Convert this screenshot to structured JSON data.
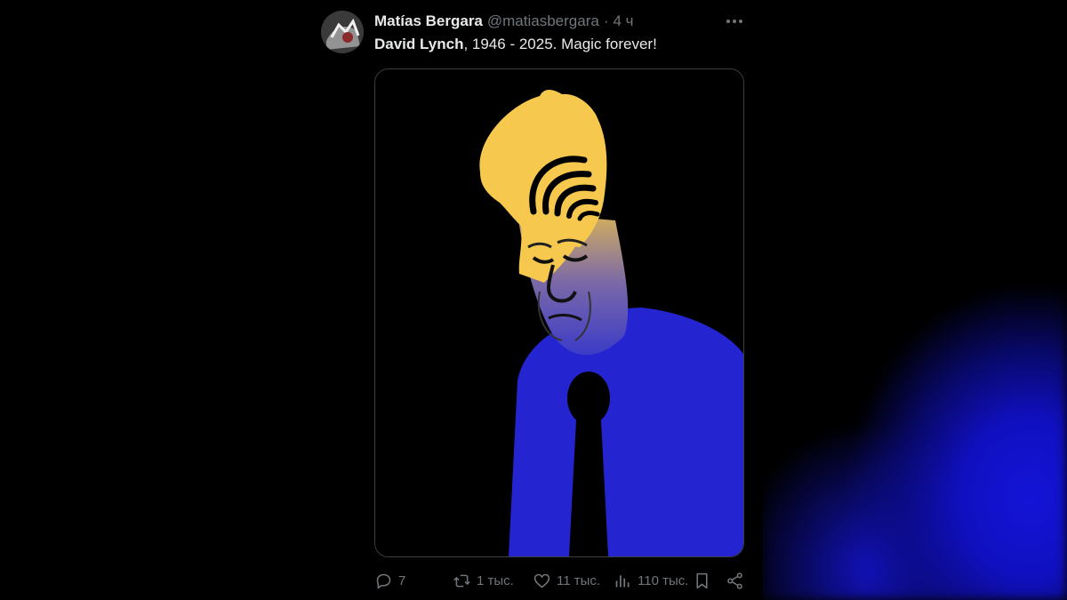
{
  "tweet": {
    "author_name": "Matías Bergara",
    "handle": "@matiasbergara",
    "separator": "·",
    "time": "4 ч",
    "text_bold": "David Lynch",
    "text_rest": ", 1946 - 2025. Magic forever!",
    "media_icon": "illustration-image"
  },
  "actions": {
    "replies": "7",
    "reposts": "1 тыс.",
    "likes": "11 тыс.",
    "views": "110 тыс."
  },
  "icons": {
    "more": "more-dots-icon",
    "reply": "reply-icon",
    "repost": "repost-icon",
    "like": "heart-icon",
    "views": "views-chart-icon",
    "bookmark": "bookmark-icon",
    "share": "share-icon"
  },
  "colors": {
    "text_primary": "#e7e9ea",
    "text_secondary": "#71767b",
    "illustration_blue": "#2222cc",
    "illustration_yellow": "#f6c84e"
  }
}
